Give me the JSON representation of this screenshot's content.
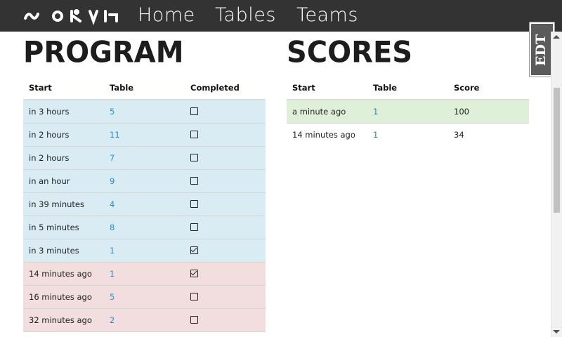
{
  "brand": {
    "logo_text": "SCORING"
  },
  "nav": {
    "links": [
      "Home",
      "Tables",
      "Teams"
    ]
  },
  "program": {
    "title": "PROGRAM",
    "columns": [
      "Start",
      "Table",
      "Completed"
    ],
    "rows": [
      {
        "start": "in 3 hours",
        "table": "5",
        "completed": false,
        "state": "upcoming"
      },
      {
        "start": "in 2 hours",
        "table": "11",
        "completed": false,
        "state": "upcoming"
      },
      {
        "start": "in 2 hours",
        "table": "7",
        "completed": false,
        "state": "upcoming"
      },
      {
        "start": "in an hour",
        "table": "9",
        "completed": false,
        "state": "upcoming"
      },
      {
        "start": "in 39 minutes",
        "table": "4",
        "completed": false,
        "state": "upcoming"
      },
      {
        "start": "in 5 minutes",
        "table": "8",
        "completed": false,
        "state": "upcoming"
      },
      {
        "start": "in 3 minutes",
        "table": "1",
        "completed": true,
        "state": "upcoming"
      },
      {
        "start": "14 minutes ago",
        "table": "1",
        "completed": true,
        "state": "past"
      },
      {
        "start": "16 minutes ago",
        "table": "5",
        "completed": false,
        "state": "past"
      },
      {
        "start": "32 minutes ago",
        "table": "2",
        "completed": false,
        "state": "past"
      }
    ]
  },
  "scores": {
    "title": "SCORES",
    "columns": [
      "Start",
      "Table",
      "Score"
    ],
    "rows": [
      {
        "start": "a minute ago",
        "table": "1",
        "score": "100",
        "state": "success"
      },
      {
        "start": "14 minutes ago",
        "table": "1",
        "score": "34",
        "state": "plain"
      }
    ]
  },
  "side_badge": {
    "text": "EDT"
  },
  "colors": {
    "navbar": "#333333",
    "upcoming_row": "#d9ecf4",
    "past_row": "#f2dede",
    "success_row": "#dff0d8",
    "link": "#2a8fc7"
  }
}
